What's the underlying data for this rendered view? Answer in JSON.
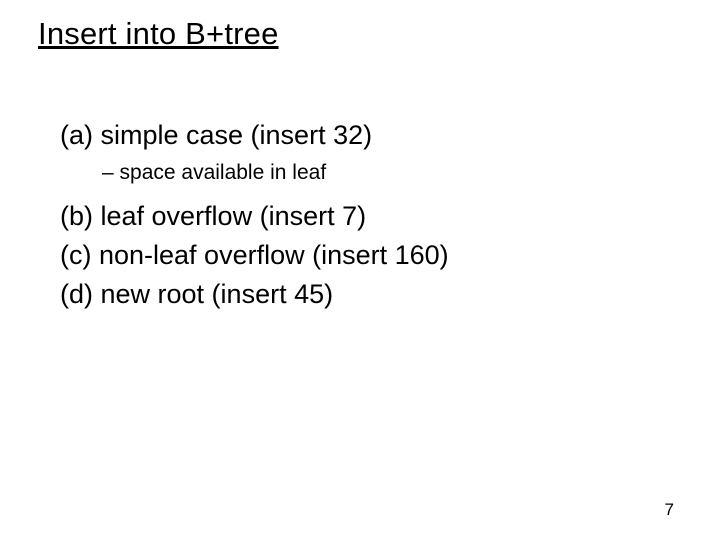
{
  "title": "Insert into B+tree",
  "items": {
    "a": "(a) simple case (insert 32)",
    "a_sub": "–  space available in leaf",
    "b": "(b) leaf overflow (insert 7)",
    "c": "(c) non-leaf overflow (insert 160)",
    "d": "(d) new root (insert 45)"
  },
  "page_number": "7"
}
